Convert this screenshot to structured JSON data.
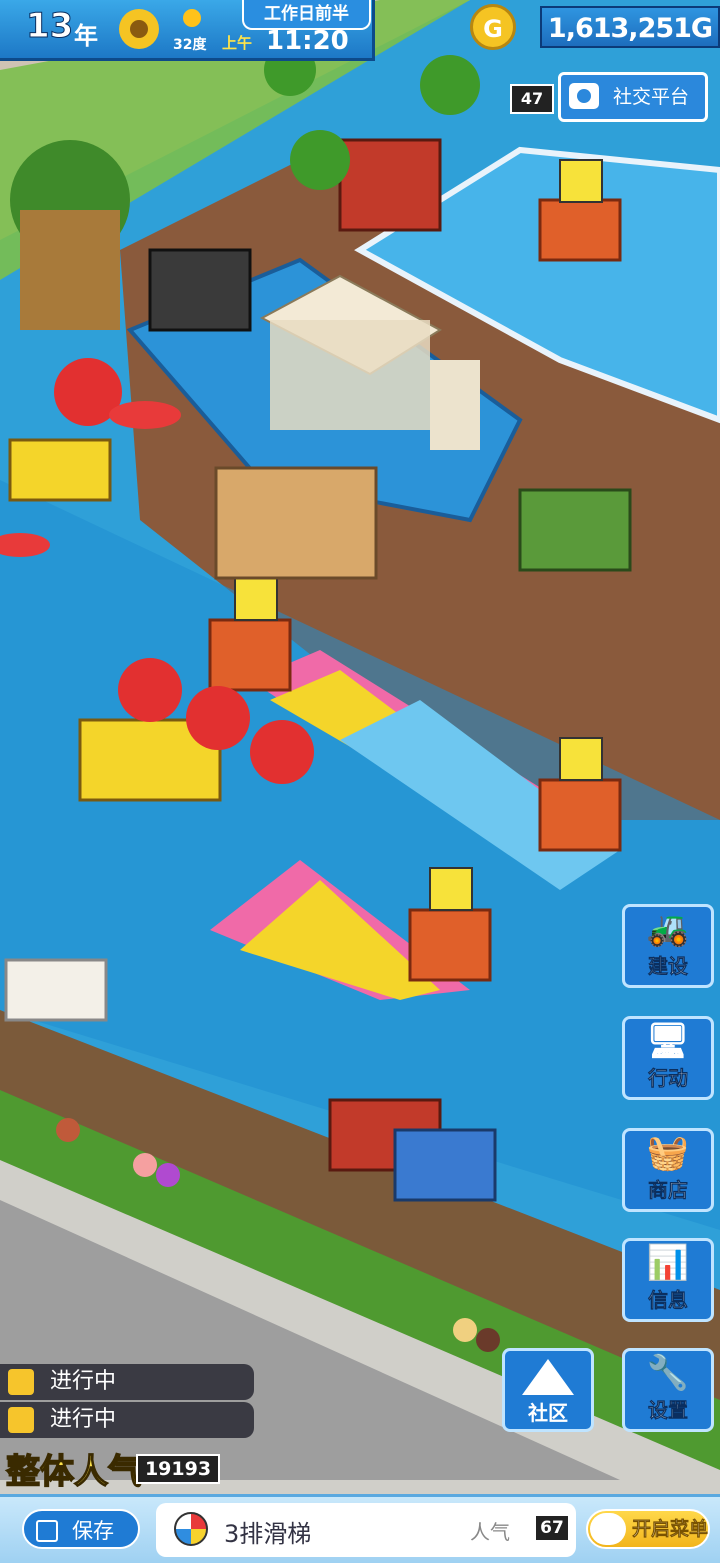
{
  "status_bar": {
    "year_number": "13",
    "year_unit": "年",
    "temperature": "32度",
    "ampm": "上午",
    "time": "11:20",
    "period": "工作日前半"
  },
  "money": {
    "coin_symbol": "G",
    "value": "1,613,251G"
  },
  "social": {
    "badge": "47",
    "label": "社交平台"
  },
  "side_menu": [
    {
      "label": "建设",
      "icon": "excavator-icon"
    },
    {
      "label": "行动",
      "icon": "computer-icon"
    },
    {
      "label": "商店",
      "icon": "shopping-basket-icon"
    },
    {
      "label": "信息",
      "icon": "bar-chart-icon"
    },
    {
      "label": "设置",
      "icon": "wrench-icon"
    }
  ],
  "community": {
    "label": "社区",
    "icon": "triangle-flag-icon"
  },
  "progress": [
    {
      "label": "进行中"
    },
    {
      "label": "进行中"
    }
  ],
  "popularity": {
    "label": "整体人气",
    "value": "19193"
  },
  "bottom_bar": {
    "save_label": "保存",
    "facility_name": "3排滑梯",
    "popularity_label": "人气",
    "popularity_value": "67",
    "menu_label": "开启菜单"
  },
  "colors": {
    "water": "#2fa0d8",
    "deck": "#8a5a3c",
    "hud_blue": "#1f7bd4",
    "accent_yellow": "#ffe44a"
  }
}
